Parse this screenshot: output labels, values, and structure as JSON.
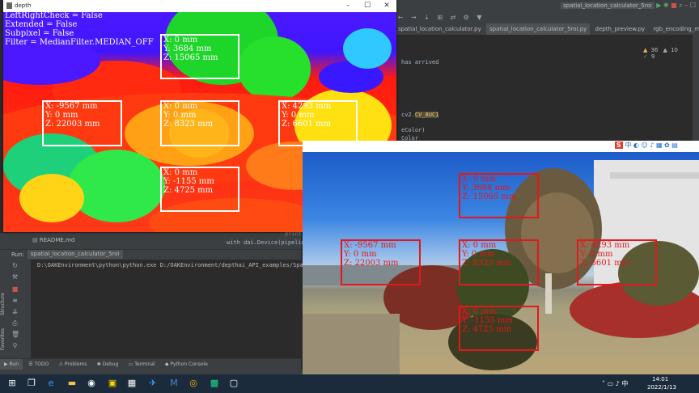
{
  "ide": {
    "tabs": [
      {
        "label": "spatial_location_calculator.py"
      },
      {
        "label": "spatial_location_calculator_5roi.py"
      },
      {
        "label": "depth_preview.py"
      },
      {
        "label": "rgb_encoding_mono"
      }
    ],
    "run_config": "spatial_location_calculator_5roi",
    "editor_lines": [
      {
        "text": "has arrived"
      },
      {
        "text": "cv2."
      },
      {
        "text": "CV_8UC1"
      },
      {
        "text": "eColor)"
      },
      {
        "text": "Color"
      }
    ],
    "inspections": {
      "warnings": "36",
      "weak": "10",
      "typos": "9"
    },
    "project_file": "README.md",
    "code_snippet": "with dai.Device(pipeline) as de...",
    "code_snippet_top": "print('Conn...')",
    "run_label": "Run:",
    "run_tab": "spatial_location_calculator_5roi",
    "console_line": "D:\\OAKEnvironment\\python\\python.exe D:/OAKEnvironment/depthai_API_examples/Spatia",
    "left_tools": [
      "Structure",
      "Favorites"
    ],
    "bottom_tabs": [
      {
        "label": "Run"
      },
      {
        "label": "TODO"
      },
      {
        "label": "Problems"
      },
      {
        "label": "Debug"
      },
      {
        "label": "Terminal"
      },
      {
        "label": "Python Console"
      }
    ]
  },
  "depth_window": {
    "title": "depth",
    "overlay_lines": [
      "LeftRightCheck = False",
      "Extended = False",
      "Subpixel = False",
      "Filter = MedianFilter.MEDIAN_OFF"
    ],
    "rois": [
      {
        "x": "X: 0 mm",
        "y": "Y: 3684 mm",
        "z": "Z: 15065 mm"
      },
      {
        "x": "X: -9567 mm",
        "y": "Y: 0 mm",
        "z": "Z: 22003 mm"
      },
      {
        "x": "X: 0 mm",
        "y": "Y: 0 mm",
        "z": "Z: 8323 mm"
      },
      {
        "x": "X: 4293 mm",
        "y": "Y: 0 mm",
        "z": "Z: 6601 mm"
      },
      {
        "x": "X: 0 mm",
        "y": "Y: -1155 mm",
        "z": "Z: 4725 mm"
      }
    ]
  },
  "rgb_window": {
    "ime_label": "S",
    "ime_lang": "中"
  },
  "taskbar": {
    "time": "14:01",
    "date": "2022/1/13"
  },
  "colors": {
    "roi_depth": "#ffffff",
    "roi_rgb": "#e3171c",
    "ide_bg": "#2b2b2b",
    "taskbar_bg": "#1c2b3b"
  }
}
